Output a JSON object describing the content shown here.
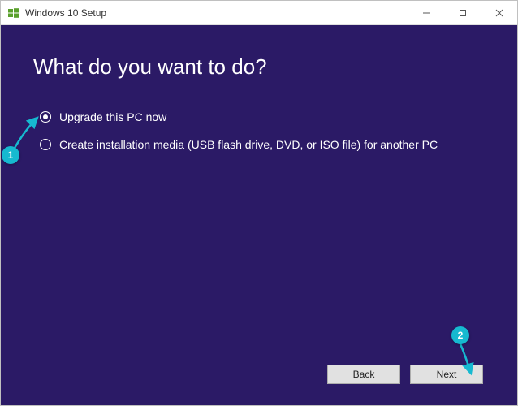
{
  "window": {
    "title": "Windows 10 Setup"
  },
  "heading": "What do you want to do?",
  "options": [
    {
      "label": "Upgrade this PC now",
      "selected": true
    },
    {
      "label": "Create installation media (USB flash drive, DVD, or ISO file) for another PC",
      "selected": false
    }
  ],
  "buttons": {
    "back": "Back",
    "next": "Next"
  },
  "annotations": {
    "marker1": "1",
    "marker2": "2"
  }
}
